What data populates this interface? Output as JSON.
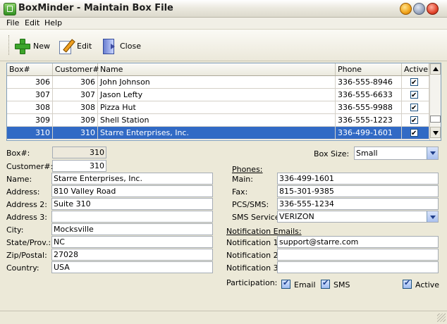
{
  "window": {
    "title": "BoxMinder - Maintain Box File"
  },
  "menu": [
    "File",
    "Edit",
    "Help"
  ],
  "toolbar": {
    "new": "New",
    "edit": "Edit",
    "close": "Close"
  },
  "grid": {
    "columns": [
      "Box#",
      "Customer#",
      "Name",
      "Phone",
      "Active"
    ],
    "rows": [
      {
        "box": "306",
        "customer": "306",
        "name": "John Johnson",
        "phone": "336-555-8946",
        "active": true
      },
      {
        "box": "307",
        "customer": "307",
        "name": "Jason Lefty",
        "phone": "336-555-6633",
        "active": true
      },
      {
        "box": "308",
        "customer": "308",
        "name": "Pizza Hut",
        "phone": "336-555-9988",
        "active": true
      },
      {
        "box": "309",
        "customer": "309",
        "name": "Shell Station",
        "phone": "336-555-1223",
        "active": true
      },
      {
        "box": "310",
        "customer": "310",
        "name": "Starre Enterprises, Inc.",
        "phone": "336-499-1601",
        "active": true
      }
    ],
    "selected_row": 4
  },
  "form": {
    "box_label": "Box#:",
    "box_value": "310",
    "customer_label": "Customer#:",
    "customer_value": "310",
    "name_label": "Name:",
    "name_value": "Starre Enterprises, Inc.",
    "address_label": "Address:",
    "address_value": "810 Valley Road",
    "address2_label": "Address 2:",
    "address2_value": "Suite 310",
    "address3_label": "Address 3:",
    "address3_value": "",
    "city_label": "City:",
    "city_value": "Mocksville",
    "state_label": "State/Prov.:",
    "state_value": "NC",
    "zip_label": "Zip/Postal:",
    "zip_value": "27028",
    "country_label": "Country:",
    "country_value": "USA",
    "boxsize_label": "Box Size:",
    "boxsize_value": "Small",
    "phones_heading": "Phones:",
    "main_label": "Main:",
    "main_value": "336-499-1601",
    "fax_label": "Fax:",
    "fax_value": "815-301-9385",
    "pcs_label": "PCS/SMS:",
    "pcs_value": "336-555-1234",
    "sms_service_label": "SMS Service:",
    "sms_service_value": "VERIZON",
    "emails_heading": "Notification Emails:",
    "notif1_label": "Notification 1:",
    "notif1_value": "support@starre.com",
    "notif2_label": "Notification 2:",
    "notif2_value": "",
    "notif3_label": "Notification 3:",
    "notif3_value": "",
    "participation_label": "Participation:",
    "email_label": "Email",
    "email_checked": true,
    "sms_label": "SMS",
    "sms_checked": true,
    "active_label": "Active",
    "active_checked": true
  }
}
